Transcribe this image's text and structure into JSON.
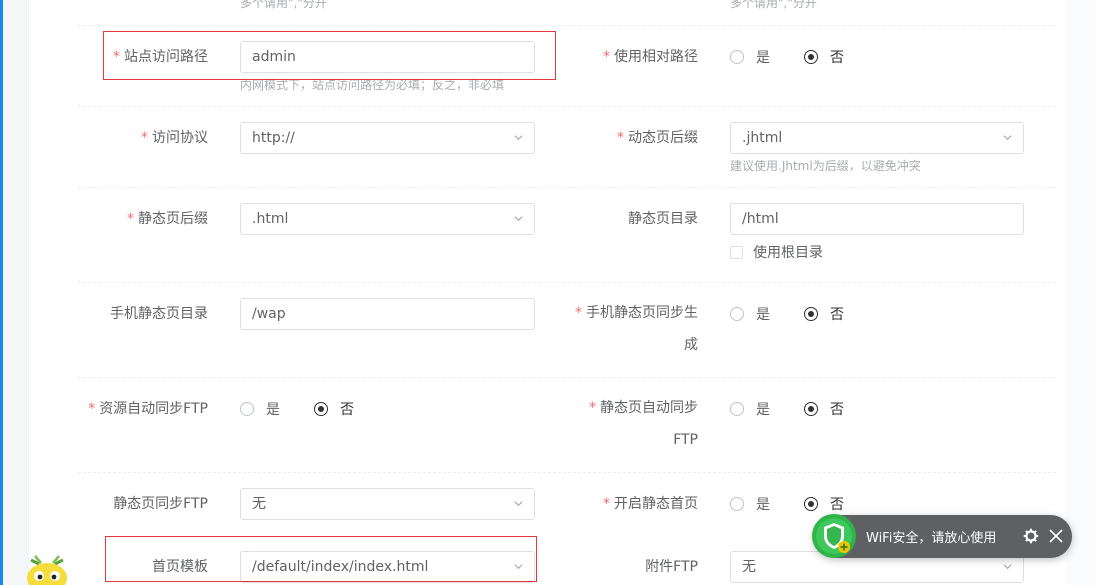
{
  "top_hints": {
    "left": "多个请用\",\"分开",
    "right": "多个请用\",\"分开"
  },
  "rows": {
    "site_path": {
      "label": "站点访问路径",
      "value": "admin",
      "hint": "内网模式下，站点访问路径为必填；反之，非必填"
    },
    "relative_path": {
      "label": "使用相对路径",
      "yes": "是",
      "no": "否",
      "selected": "no"
    },
    "protocol": {
      "label": "访问协议",
      "value": "http://"
    },
    "dynamic_suffix": {
      "label": "动态页后缀",
      "value": ".jhtml",
      "hint": "建议使用.Jhtml为后缀，以避免冲突"
    },
    "static_suffix": {
      "label": "静态页后缀",
      "value": ".html"
    },
    "static_dir": {
      "label": "静态页目录",
      "value": "/html",
      "use_root": "使用根目录"
    },
    "mobile_static_dir": {
      "label": "手机静态页目录",
      "value": "/wap"
    },
    "mobile_static_sync": {
      "label_line1": "手机静态页同步生",
      "label_line2": "成",
      "yes": "是",
      "no": "否",
      "selected": "no"
    },
    "resource_ftp": {
      "label": "资源自动同步FTP",
      "yes": "是",
      "no": "否",
      "selected": "no"
    },
    "static_auto_sync": {
      "label_line1": "静态页自动同步",
      "label_line2": "FTP",
      "yes": "是",
      "no": "否",
      "selected": "no"
    },
    "static_sync_ftp": {
      "label": "静态页同步FTP",
      "value": "无"
    },
    "static_home": {
      "label": "开启静态首页",
      "yes": "是",
      "no": "否",
      "selected": "no"
    },
    "home_template": {
      "label": "首页模板",
      "value": "/default/index/index.html"
    },
    "attachment_ftp": {
      "label": "附件FTP",
      "value": "无"
    }
  },
  "toast": {
    "message": "WiFi安全，请放心使用"
  },
  "colors": {
    "required": "#f56c6c",
    "highlight_box": "#e4393c",
    "accent": "#1e88e5"
  },
  "icons": [
    "chevron-down-icon",
    "wifi-shield-icon",
    "gear-icon",
    "close-icon",
    "mascot-icon"
  ]
}
